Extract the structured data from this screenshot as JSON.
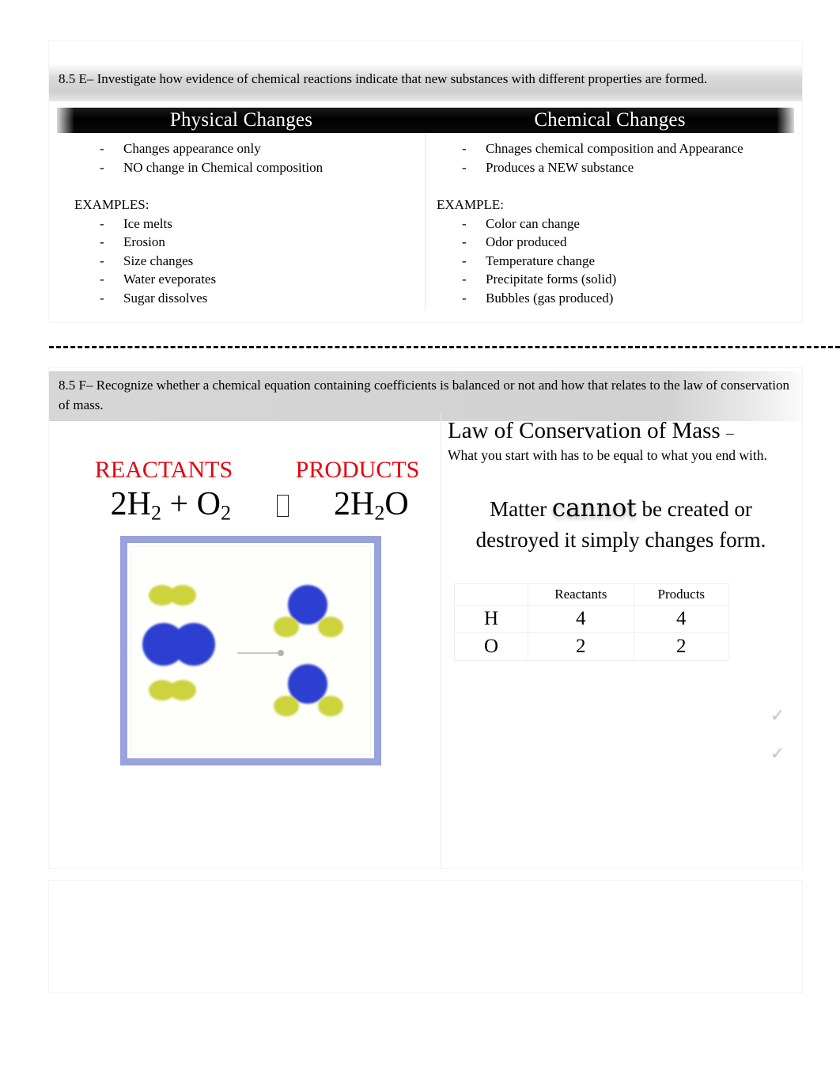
{
  "section_one": {
    "teks": "8.5 E– Investigate how evidence of chemical reactions indicate that new substances with different properties are formed.",
    "title_left": "Physical Changes",
    "title_right": "Chemical Changes",
    "left_points": [
      "Changes appearance only",
      "NO change in Chemical composition"
    ],
    "left_examples_label": "EXAMPLES:",
    "left_examples": [
      "Ice melts",
      "Erosion",
      "Size changes",
      "Water eveporates",
      "Sugar dissolves"
    ],
    "right_points": [
      "Chnages chemical composition and Appearance",
      "Produces a NEW substance"
    ],
    "right_examples_label": "EXAMPLE:",
    "right_examples": [
      "Color can change",
      "Odor produced",
      "Temperature change",
      "Precipitate forms (solid)",
      "Bubbles (gas produced)"
    ]
  },
  "section_two": {
    "teks": "8.5 F– Recognize whether a chemical equation containing coefficients is balanced or not and how that relates to the law of conservation of mass.",
    "reactants_label": "REACTANTS",
    "products_label": "PRODUCTS",
    "reactants_label_color": "#e8000d",
    "equation": {
      "lhs_prefix": "2H",
      "lhs_sub1": "2",
      "lhs_mid": " + O",
      "lhs_sub2": "2",
      "arrow_glyph": "missing-glyph-box",
      "rhs_prefix": "2H",
      "rhs_sub": "2",
      "rhs_suffix": "O"
    },
    "law_title": "Law of Conservation of Mass",
    "law_title_dash": "–",
    "law_sub": "What you start with has to be equal to what you end with.",
    "matter_part1": "Matter",
    "matter_emphasis": "cannot",
    "matter_part2": "be created or destroyed it simply changes form.",
    "count_table": {
      "headers": [
        "",
        "Reactants",
        "Products"
      ],
      "rows": [
        {
          "element": "H",
          "reactants": "4",
          "products": "4"
        },
        {
          "element": "O",
          "reactants": "2",
          "products": "2"
        }
      ]
    },
    "check_marks": [
      "✓",
      "✓"
    ],
    "molecule_diagram": {
      "frame_color": "#98a2dd",
      "hydrogen_color": "#cdd33d",
      "oxygen_color": "#2c3fd1",
      "left_side": "2 hydrogen molecules and 1 oxygen molecule",
      "right_side": "2 water molecules"
    }
  }
}
